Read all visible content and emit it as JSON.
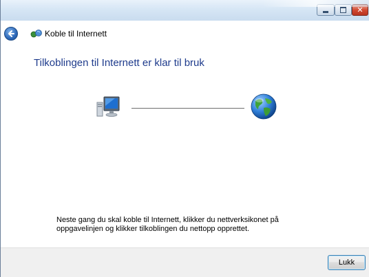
{
  "window": {
    "title_icon": "network-icon",
    "controls": {
      "minimize_icon": "minimize-icon",
      "maximize_icon": "maximize-icon",
      "close_icon": "close-icon",
      "close_color": "#c8402b"
    }
  },
  "nav": {
    "back_icon": "back-arrow-icon",
    "wizard_title": "Koble til Internett",
    "wizard_icon": "network-connect-icon"
  },
  "main": {
    "heading": "Tilkoblingen til Internett er klar til bruk",
    "heading_color": "#1e3b8c",
    "diagram": {
      "left_icon": "computer-icon",
      "right_icon": "globe-icon"
    },
    "instruction": "Neste gang du skal koble til Internett, klikker du nettverksikonet på oppgavelinjen og klikker tilkoblingen du nettopp opprettet."
  },
  "footer": {
    "close_label": "Lukk"
  }
}
